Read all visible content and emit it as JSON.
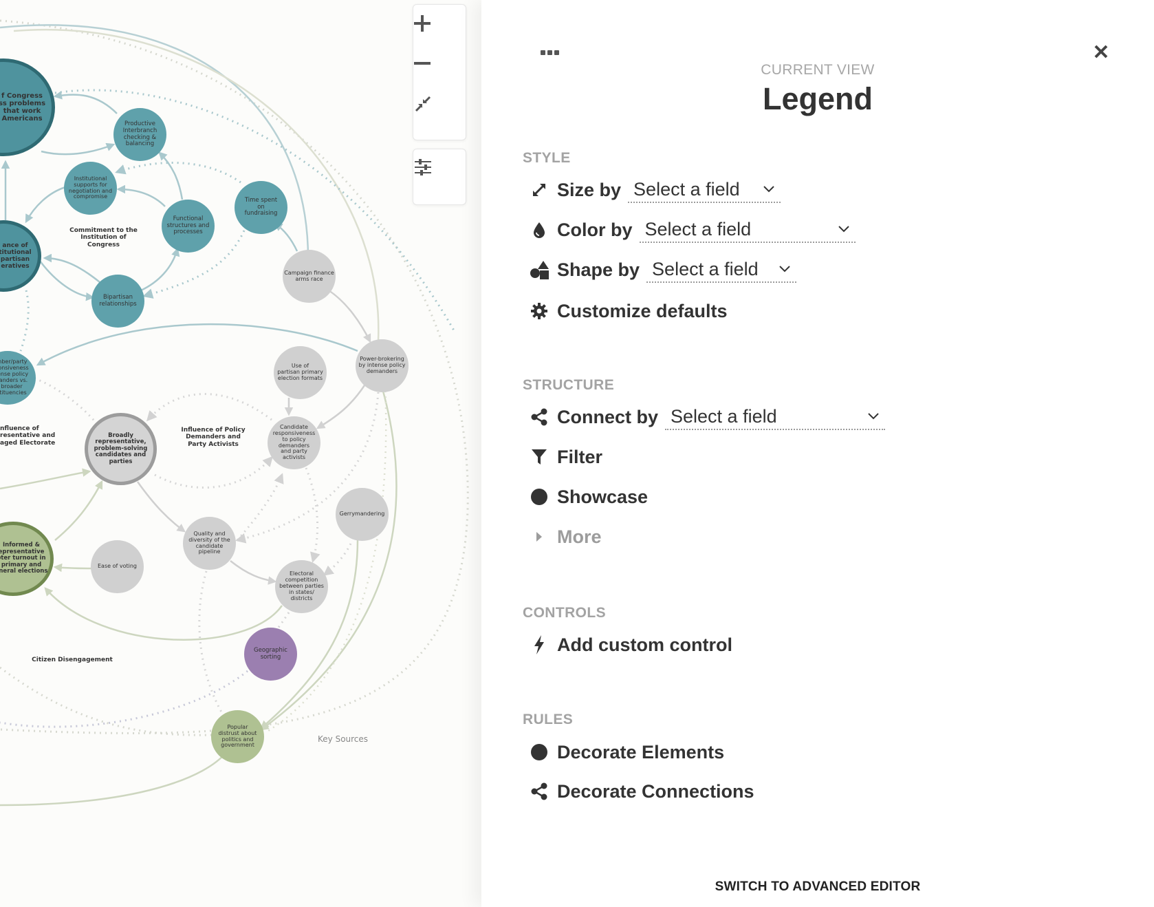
{
  "canvas": {
    "nodes": [
      {
        "id": "n1",
        "text": "f Congress\nss problems\nthat work\nAmericans",
        "bold": true
      },
      {
        "id": "n2",
        "text": "Productive\nInterbranch\nchecking &\nbalancing"
      },
      {
        "id": "n3",
        "text": "Institutional\nsupports for\nnegotiation and\ncompromise"
      },
      {
        "id": "n4",
        "text": "ance of\ntitutional\npartisan\neratives",
        "bold": true
      },
      {
        "id": "n5",
        "text": "Functional\nstructures and\nprocesses"
      },
      {
        "id": "n6",
        "text": "Time spent\non\nfundraising"
      },
      {
        "id": "n7",
        "text": "Bipartisan\nrelationships"
      },
      {
        "id": "n8",
        "text": "Campaign finance\narms race"
      },
      {
        "id": "n9",
        "text": "mber/party\nponsiveness\ntense policy\nnanders vs.\nbroader\nstituencies"
      },
      {
        "id": "n10",
        "text": "Power-brokering\nby intense policy\ndemanders"
      },
      {
        "id": "n11",
        "text": "Use of\npartisan primary\nelection formats"
      },
      {
        "id": "n12",
        "text": "Broadly\nrepresentative,\nproblem-solving\ncandidates and\nparties",
        "bold": true
      },
      {
        "id": "n13",
        "text": "Candidate\nresponsiveness\nto policy\ndemanders\nand party\nactivists"
      },
      {
        "id": "n14",
        "text": "Gerrymandering"
      },
      {
        "id": "n15",
        "text": "Informed &\nepresentative\noter turnout in\nprimary and\neneral elections",
        "bold": true
      },
      {
        "id": "n16",
        "text": "Ease of voting"
      },
      {
        "id": "n17",
        "text": "Quality and\ndiversity of the\ncandidate\npipeline"
      },
      {
        "id": "n18",
        "text": "Electoral\ncompetition\nbetween parties\nin states/\ndistricts"
      },
      {
        "id": "n19",
        "text": "Geographic\nsorting"
      },
      {
        "id": "n20",
        "text": "Popular\ndistrust about\npolitics and\ngovernment"
      }
    ],
    "group_labels": [
      {
        "id": "g1",
        "text": "Commitment to the\nInstitution of\nCongress"
      },
      {
        "id": "g2",
        "text": "nfluence of\nresentative and\naged Electorate"
      },
      {
        "id": "g3",
        "text": "Influence of Policy\nDemanders and\nParty Activists"
      },
      {
        "id": "g4",
        "text": "Citizen Disengagement"
      }
    ],
    "key_sources": "Key Sources",
    "colors": {
      "teal": "#5fa1ab",
      "gray": "#d0d0d0",
      "green": "#afc192",
      "purple": "#9b7fb0"
    }
  },
  "zoom_controls": {
    "zoom_in_icon": "plus-icon",
    "zoom_out_icon": "minus-icon",
    "fit_icon": "compress-icon",
    "settings_icon": "sliders-icon"
  },
  "panel": {
    "current_view_label": "CURRENT VIEW",
    "title": "Legend",
    "style": {
      "heading": "STYLE",
      "size_by": {
        "label": "Size by",
        "value": "Select a field"
      },
      "color_by": {
        "label": "Color by",
        "value": "Select a field"
      },
      "shape_by": {
        "label": "Shape by",
        "value": "Select a field"
      },
      "customize": "Customize defaults"
    },
    "structure": {
      "heading": "STRUCTURE",
      "connect_by": {
        "label": "Connect by",
        "value": "Select a field"
      },
      "filter": "Filter",
      "showcase": "Showcase",
      "more": "More"
    },
    "controls": {
      "heading": "CONTROLS",
      "add_custom": "Add custom control"
    },
    "rules": {
      "heading": "RULES",
      "decorate_elements": "Decorate Elements",
      "decorate_connections": "Decorate Connections"
    },
    "switch_advanced": "SWITCH TO ADVANCED EDITOR"
  }
}
